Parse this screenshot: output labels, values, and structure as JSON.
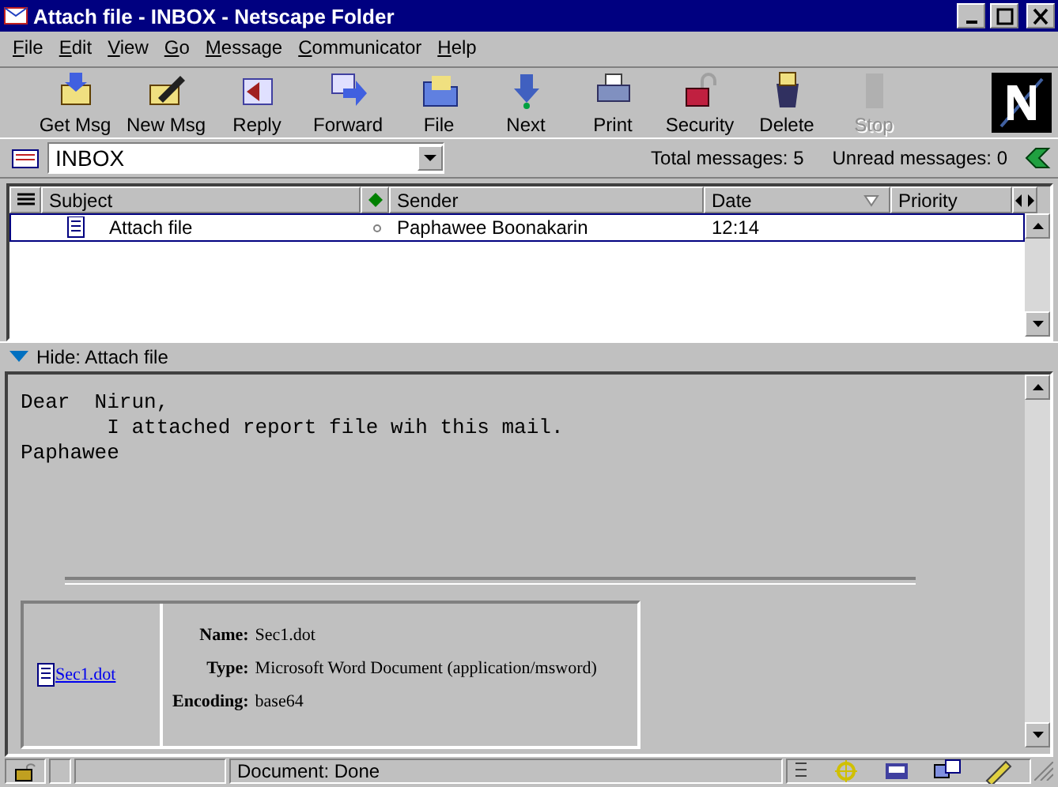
{
  "window": {
    "title": "Attach file - INBOX - Netscape Folder"
  },
  "menu": [
    "File",
    "Edit",
    "View",
    "Go",
    "Message",
    "Communicator",
    "Help"
  ],
  "toolbar": [
    {
      "label": "Get Msg",
      "disabled": false
    },
    {
      "label": "New Msg",
      "disabled": false
    },
    {
      "label": "Reply",
      "disabled": false
    },
    {
      "label": "Forward",
      "disabled": false
    },
    {
      "label": "File",
      "disabled": false
    },
    {
      "label": "Next",
      "disabled": false
    },
    {
      "label": "Print",
      "disabled": false
    },
    {
      "label": "Security",
      "disabled": false
    },
    {
      "label": "Delete",
      "disabled": false
    },
    {
      "label": "Stop",
      "disabled": true
    }
  ],
  "folder": {
    "value": "INBOX",
    "total": "Total messages: 5",
    "unread": "Unread messages: 0"
  },
  "columns": [
    "Subject",
    "Sender",
    "Date",
    "Priority"
  ],
  "messages": [
    {
      "subject": "Attach file",
      "sender": "Paphawee Boonakarin",
      "date": "12:14",
      "selected": true
    }
  ],
  "preview_header": "Hide: Attach file",
  "body": [
    "Dear  Nirun,",
    "       I attached report file wih this mail.",
    "Paphawee"
  ],
  "attachment": {
    "link": "Sec1.dot",
    "fields": [
      {
        "label": "Name:",
        "value": "Sec1.dot"
      },
      {
        "label": "Type:",
        "value": "Microsoft Word Document (application/msword)"
      },
      {
        "label": "Encoding:",
        "value": "base64"
      }
    ]
  },
  "status": "Document: Done"
}
